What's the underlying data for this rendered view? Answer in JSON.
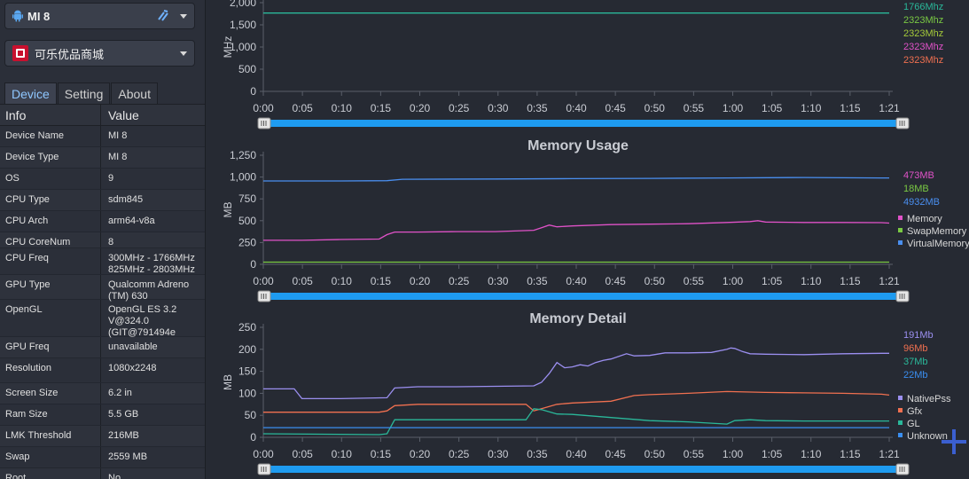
{
  "device_select": {
    "value": "MI 8"
  },
  "app_select": {
    "value": "可乐优品商城"
  },
  "tabs": [
    {
      "label": "Device",
      "active": true
    },
    {
      "label": "Setting",
      "active": false
    },
    {
      "label": "About",
      "active": false
    }
  ],
  "table": {
    "headers": [
      "Info",
      "Value"
    ],
    "rows": [
      {
        "key": "Device Name",
        "value": "MI 8"
      },
      {
        "key": "Device Type",
        "value": "MI 8"
      },
      {
        "key": "OS",
        "value": "9"
      },
      {
        "key": "CPU Type",
        "value": "sdm845"
      },
      {
        "key": "CPU Arch",
        "value": "arm64-v8a"
      },
      {
        "key": "CPU CoreNum",
        "value": "8"
      },
      {
        "key": "CPU Freq",
        "value": "300MHz - 1766MHz\n825MHz - 2803MHz"
      },
      {
        "key": "GPU Type",
        "value": "Qualcomm Adreno\n(TM) 630"
      },
      {
        "key": "OpenGL",
        "value": "OpenGL ES 3.2\nV@324.0\n(GIT@791494e"
      },
      {
        "key": "GPU Freq",
        "value": "unavailable"
      },
      {
        "key": "Resolution",
        "value": "1080x2248"
      },
      {
        "key": "Screen Size",
        "value": "6.2 in"
      },
      {
        "key": "Ram Size",
        "value": "5.5 GB"
      },
      {
        "key": "LMK Threshold",
        "value": "216MB"
      },
      {
        "key": "Swap",
        "value": "2559 MB"
      },
      {
        "key": "Root",
        "value": "No"
      }
    ]
  },
  "colors": {
    "accent": "#1e9bf0",
    "memory": "#e052c8",
    "swap": "#7ac943",
    "virtual": "#4a8ff0",
    "nativepss": "#9b8ff0",
    "gfx": "#f07050",
    "gl": "#2ab89a",
    "unknown": "#3a8ef0"
  },
  "chart_data": [
    {
      "type": "line",
      "title": "",
      "ylabel": "MHz",
      "ylim": [
        0,
        2000
      ],
      "yticks": [
        "0",
        "500",
        "1,000",
        "1,500",
        "2,000"
      ],
      "x_ticks": [
        "0:00",
        "0:05",
        "0:10",
        "0:15",
        "0:20",
        "0:25",
        "0:30",
        "0:35",
        "0:40",
        "0:45",
        "0:50",
        "0:55",
        "1:00",
        "1:05",
        "1:10",
        "1:15",
        "1:21"
      ],
      "value_labels": [
        {
          "text": "1766Mhz",
          "color": "#2ab89a"
        },
        {
          "text": "2323Mhz",
          "color": "#7ac943"
        },
        {
          "text": "2323Mhz",
          "color": "#a4c93a"
        },
        {
          "text": "2323Mhz",
          "color": "#e052c8"
        },
        {
          "text": "2323Mhz",
          "color": "#f07050"
        }
      ],
      "series": [
        {
          "color": "#2ab89a",
          "x": [
            0,
            81
          ],
          "y": [
            1766,
            1766
          ]
        }
      ]
    },
    {
      "type": "line",
      "title": "Memory Usage",
      "ylabel": "MB",
      "ylim": [
        0,
        1250
      ],
      "yticks": [
        "0",
        "250",
        "500",
        "750",
        "1,000",
        "1,250"
      ],
      "x_ticks": [
        "0:00",
        "0:05",
        "0:10",
        "0:15",
        "0:20",
        "0:25",
        "0:30",
        "0:35",
        "0:40",
        "0:45",
        "0:50",
        "0:55",
        "1:00",
        "1:05",
        "1:10",
        "1:15",
        "1:21"
      ],
      "value_labels": [
        {
          "text": "473MB",
          "color": "#e052c8"
        },
        {
          "text": "18MB",
          "color": "#7ac943"
        },
        {
          "text": "4932MB",
          "color": "#4a8ff0"
        }
      ],
      "series": [
        {
          "name": "Memory",
          "color": "#e052c8",
          "x": [
            0,
            5,
            10,
            15,
            16,
            17,
            20,
            25,
            30,
            35,
            36,
            37,
            38,
            40,
            45,
            50,
            55,
            60,
            63,
            64,
            65,
            70,
            75,
            80,
            81
          ],
          "y": [
            275,
            275,
            285,
            290,
            340,
            370,
            370,
            375,
            375,
            390,
            420,
            450,
            430,
            440,
            455,
            460,
            465,
            480,
            490,
            500,
            485,
            480,
            480,
            478,
            473
          ]
        },
        {
          "name": "SwapMemory",
          "color": "#7ac943",
          "x": [
            0,
            81
          ],
          "y": [
            25,
            25
          ]
        },
        {
          "name": "VirtualMemory",
          "color": "#4a8ff0",
          "x": [
            0,
            10,
            16,
            18,
            30,
            40,
            50,
            60,
            70,
            80,
            81
          ],
          "y": [
            955,
            955,
            958,
            975,
            978,
            982,
            985,
            990,
            995,
            990,
            990
          ]
        }
      ],
      "legend": [
        "Memory",
        "SwapMemory",
        "VirtualMemory"
      ]
    },
    {
      "type": "line",
      "title": "Memory Detail",
      "ylabel": "MB",
      "ylim": [
        0,
        250
      ],
      "yticks": [
        "0",
        "50",
        "100",
        "150",
        "200",
        "250"
      ],
      "x_ticks": [
        "0:00",
        "0:05",
        "0:10",
        "0:15",
        "0:20",
        "0:25",
        "0:30",
        "0:35",
        "0:40",
        "0:45",
        "0:50",
        "0:55",
        "1:00",
        "1:05",
        "1:10",
        "1:15",
        "1:21"
      ],
      "value_labels": [
        {
          "text": "191Mb",
          "color": "#9b8ff0"
        },
        {
          "text": "96Mb",
          "color": "#f07050"
        },
        {
          "text": "37Mb",
          "color": "#2ab89a"
        },
        {
          "text": "22Mb",
          "color": "#3a8ef0"
        }
      ],
      "series": [
        {
          "name": "NativePss",
          "color": "#9b8ff0",
          "x": [
            0,
            4,
            5,
            10,
            16,
            17,
            20,
            25,
            30,
            35,
            36,
            37,
            38,
            39,
            40,
            41,
            42,
            43,
            44,
            45,
            47,
            48,
            50,
            52,
            55,
            58,
            60,
            60.5,
            61,
            62,
            63,
            65,
            70,
            75,
            80,
            81
          ],
          "y": [
            110,
            110,
            88,
            88,
            90,
            112,
            115,
            115,
            116,
            117,
            125,
            145,
            170,
            158,
            160,
            165,
            162,
            170,
            175,
            178,
            190,
            185,
            186,
            192,
            192,
            193,
            200,
            203,
            202,
            195,
            190,
            189,
            188,
            190,
            191,
            191
          ]
        },
        {
          "name": "Gfx",
          "color": "#f07050",
          "x": [
            0,
            15,
            16,
            17,
            20,
            25,
            30,
            34,
            35,
            36,
            38,
            40,
            45,
            48,
            50,
            55,
            60,
            65,
            70,
            75,
            80,
            81
          ],
          "y": [
            57,
            57,
            60,
            72,
            75,
            75,
            75,
            75,
            60,
            65,
            75,
            78,
            82,
            95,
            97,
            100,
            104,
            102,
            101,
            100,
            98,
            96
          ]
        },
        {
          "name": "GL",
          "color": "#2ab89a",
          "x": [
            0,
            15,
            16,
            17,
            20,
            25,
            30,
            34,
            35,
            36,
            38,
            40,
            45,
            50,
            55,
            60,
            61,
            63,
            65,
            70,
            75,
            80,
            81
          ],
          "y": [
            8,
            6,
            8,
            40,
            40,
            40,
            40,
            40,
            65,
            63,
            53,
            52,
            45,
            38,
            35,
            30,
            38,
            40,
            38,
            37,
            37,
            37,
            37
          ]
        },
        {
          "name": "Unknown",
          "color": "#3a8ef0",
          "x": [
            0,
            81
          ],
          "y": [
            22,
            22
          ]
        }
      ],
      "legend": [
        "NativePss",
        "Gfx",
        "GL",
        "Unknown"
      ]
    }
  ]
}
